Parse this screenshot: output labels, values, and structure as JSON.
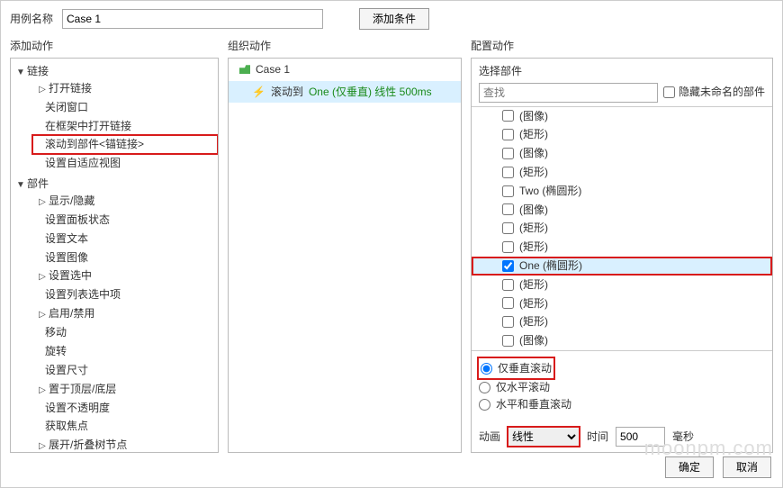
{
  "header": {
    "name_label": "用例名称",
    "name_value": "Case 1",
    "add_condition": "添加条件"
  },
  "sections": {
    "add_action": "添加动作",
    "organize": "组织动作",
    "configure": "配置动作"
  },
  "tree": {
    "link_group": "链接",
    "link_items": [
      "打开链接",
      "关闭窗口",
      "在框架中打开链接",
      "滚动到部件<锚链接>",
      "设置自适应视图"
    ],
    "widget_group": "部件",
    "widget_items": [
      "显示/隐藏",
      "设置面板状态",
      "设置文本",
      "设置图像",
      "设置选中",
      "设置列表选中项",
      "启用/禁用",
      "移动",
      "旋转",
      "设置尺寸",
      "置于顶层/底层",
      "设置不透明度",
      "获取焦点",
      "展开/折叠树节点"
    ],
    "highlight": "滚动到部件<锚链接>",
    "sub_collapsed": [
      "打开链接",
      "显示/隐藏",
      "设置选中",
      "启用/禁用",
      "置于顶层/底层",
      "展开/折叠树节点"
    ]
  },
  "organize": {
    "case_label": "Case 1",
    "action_prefix": "滚动到",
    "action_target": "One (仅垂直) 线性 500ms"
  },
  "configure": {
    "select_widget": "选择部件",
    "search_placeholder": "查找",
    "hide_unnamed": "隐藏未命名的部件",
    "items": [
      {
        "label": "(图像)"
      },
      {
        "label": "(矩形)"
      },
      {
        "label": "(图像)"
      },
      {
        "label": "(矩形)"
      },
      {
        "label": "Two (椭圆形)"
      },
      {
        "label": "(图像)"
      },
      {
        "label": "(矩形)"
      },
      {
        "label": "(矩形)"
      },
      {
        "label": "One (椭圆形)",
        "checked": true,
        "hl": true
      },
      {
        "label": "(矩形)"
      },
      {
        "label": "(矩形)"
      },
      {
        "label": "(矩形)"
      },
      {
        "label": "(图像)"
      }
    ],
    "radios": {
      "vert": "仅垂直滚动",
      "horiz": "仅水平滚动",
      "both": "水平和垂直滚动",
      "selected": "vert"
    },
    "anim_label": "动画",
    "anim_value": "线性",
    "time_label": "时间",
    "time_value": "500",
    "time_unit": "毫秒"
  },
  "footer": {
    "ok": "确定",
    "cancel": "取消"
  },
  "watermark": "moonpm.com"
}
